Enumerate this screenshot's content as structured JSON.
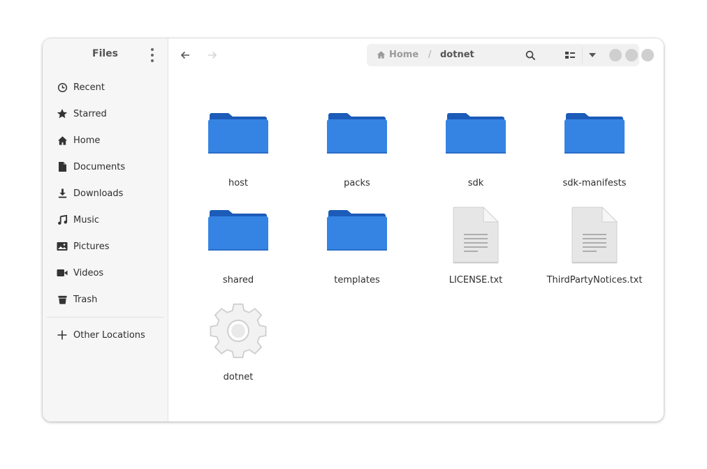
{
  "sidebar": {
    "title": "Files",
    "items": [
      {
        "label": "Recent",
        "icon": "clock-icon"
      },
      {
        "label": "Starred",
        "icon": "star-icon"
      },
      {
        "label": "Home",
        "icon": "home-icon"
      },
      {
        "label": "Documents",
        "icon": "document-icon"
      },
      {
        "label": "Downloads",
        "icon": "download-icon"
      },
      {
        "label": "Music",
        "icon": "music-icon"
      },
      {
        "label": "Pictures",
        "icon": "picture-icon"
      },
      {
        "label": "Videos",
        "icon": "video-icon"
      },
      {
        "label": "Trash",
        "icon": "trash-icon"
      }
    ],
    "other_locations": "Other Locations"
  },
  "pathbar": {
    "home": "Home",
    "separator": "/",
    "current": "dotnet"
  },
  "files": [
    {
      "name": "host",
      "type": "folder"
    },
    {
      "name": "packs",
      "type": "folder"
    },
    {
      "name": "sdk",
      "type": "folder"
    },
    {
      "name": "sdk-manifests",
      "type": "folder"
    },
    {
      "name": "shared",
      "type": "folder"
    },
    {
      "name": "templates",
      "type": "folder"
    },
    {
      "name": "LICENSE.txt",
      "type": "text-file"
    },
    {
      "name": "ThirdPartyNotices.txt",
      "type": "text-file"
    },
    {
      "name": "dotnet",
      "type": "executable"
    }
  ],
  "colors": {
    "folder_front": "#3584e4",
    "folder_back": "#1c5bb8",
    "window_buttons": "#cfcfcf"
  }
}
